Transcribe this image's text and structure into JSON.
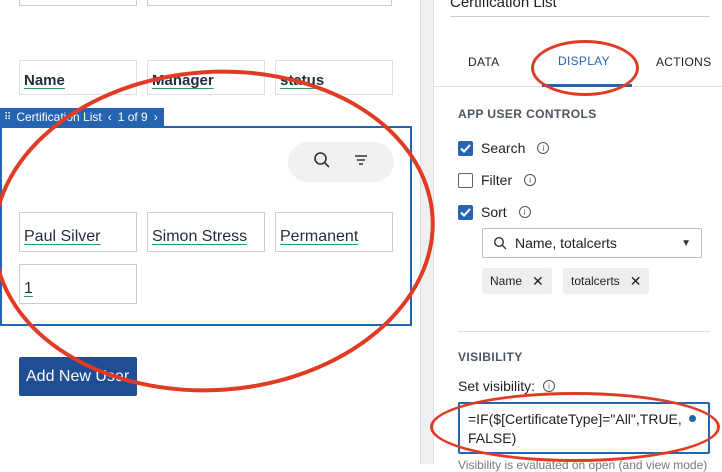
{
  "canvas": {
    "header_cells": [
      "Name",
      "Manager",
      "status"
    ],
    "list_tag": {
      "label": "Certification List",
      "pager": "1 of 9"
    },
    "row_cells": [
      "Paul Silver",
      "Simon Stress",
      "Permanent"
    ],
    "count_cell": "1",
    "add_button": "Add New User"
  },
  "panel": {
    "title": "Certification List",
    "tabs": [
      "DATA",
      "DISPLAY",
      "ACTIONS"
    ],
    "controls_title": "APP USER CONTROLS",
    "controls": [
      {
        "label": "Search",
        "checked": true
      },
      {
        "label": "Filter",
        "checked": false
      },
      {
        "label": "Sort",
        "checked": true
      }
    ],
    "sort_value": "Name, totalcerts",
    "sort_chips": [
      "Name",
      "totalcerts"
    ],
    "visibility_title": "VISIBILITY",
    "visibility_label": "Set visibility:",
    "visibility_formula": "=IF($[CertificateType]=\"All\",TRUE,FALSE)",
    "visibility_hint": "Visibility is evaluated on open (and view mode)"
  },
  "colors": {
    "accent": "#2564b0",
    "annotation": "#e23b24",
    "button": "#1f4e94"
  }
}
